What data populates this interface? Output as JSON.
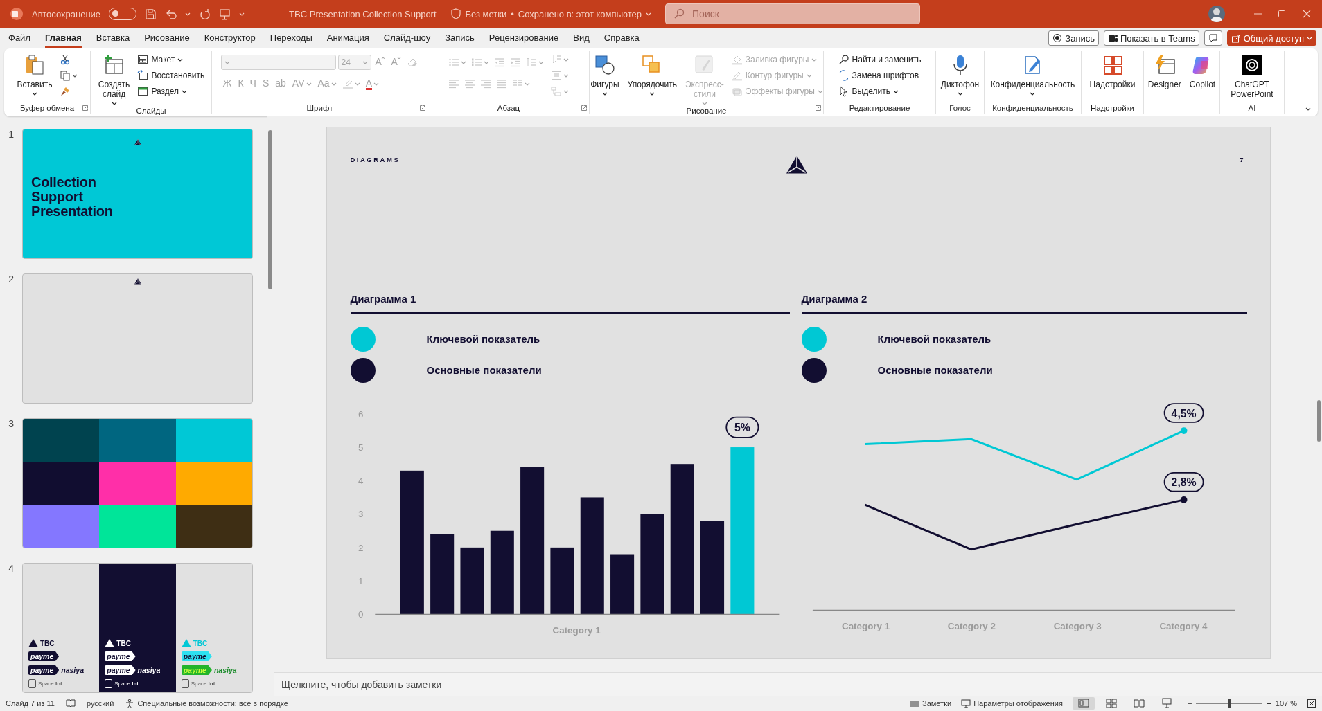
{
  "title_bar": {
    "autosave": {
      "label": "Автосохранение",
      "on": false
    },
    "document_title": "TBC Presentation Collection Support",
    "sensitivity": "Без метки",
    "separator": "•",
    "save_status": "Сохранено в: этот компьютер",
    "search": {
      "placeholder": "Поиск"
    }
  },
  "menu": {
    "tabs": [
      {
        "label": "Файл",
        "selected": false
      },
      {
        "label": "Главная",
        "selected": true
      },
      {
        "label": "Вставка",
        "selected": false
      },
      {
        "label": "Рисование",
        "selected": false
      },
      {
        "label": "Конструктор",
        "selected": false
      },
      {
        "label": "Переходы",
        "selected": false
      },
      {
        "label": "Анимация",
        "selected": false
      },
      {
        "label": "Слайд-шоу",
        "selected": false
      },
      {
        "label": "Запись",
        "selected": false
      },
      {
        "label": "Рецензирование",
        "selected": false
      },
      {
        "label": "Вид",
        "selected": false
      },
      {
        "label": "Справка",
        "selected": false
      }
    ],
    "actions": [
      {
        "kind": "record",
        "label": "Запись"
      },
      {
        "kind": "teams",
        "label": "Показать в Teams"
      },
      {
        "kind": "comment"
      },
      {
        "kind": "share",
        "label": "Общий доступ"
      }
    ]
  },
  "ribbon": {
    "groups": [
      {
        "label": "Буфер обмена",
        "launcher": true,
        "items": [
          {
            "kind": "large",
            "label": "Вставить",
            "caret": true,
            "disabled": false
          },
          {
            "kind": "column",
            "items": [
              {
                "kind": "icon",
                "caret": false,
                "disabled": false
              },
              {
                "kind": "icon",
                "caret": true,
                "disabled": false
              },
              {
                "kind": "icon",
                "caret": false,
                "disabled": false
              }
            ]
          }
        ]
      },
      {
        "label": "Слайды",
        "launcher": false,
        "items": [
          {
            "kind": "large",
            "label": "Создать слайд",
            "caret": true,
            "disabled": false
          },
          {
            "kind": "column",
            "items": [
              {
                "kind": "small",
                "label": "Макет",
                "caret": true,
                "disabled": false
              },
              {
                "kind": "small",
                "label": "Восстановить",
                "caret": false,
                "disabled": false
              },
              {
                "kind": "small",
                "label": "Раздел",
                "caret": true,
                "disabled": false
              }
            ]
          }
        ]
      },
      {
        "label": "Шрифт",
        "launcher": true,
        "items": [
          {
            "kind": "column",
            "items": [
              {
                "kind": "row",
                "items": [
                  {
                    "kind": "combo",
                    "caret": true,
                    "disabled": true
                  },
                  {
                    "kind": "field",
                    "value": "24",
                    "caret": true,
                    "disabled": true
                  },
                  {
                    "kind": "glyph",
                    "label": "Aˆ",
                    "underline": false,
                    "caret": false,
                    "disabled": true
                  },
                  {
                    "kind": "glyph",
                    "label": "Aˇ",
                    "underline": false,
                    "caret": false,
                    "disabled": true
                  },
                  {
                    "kind": "icon",
                    "caret": false,
                    "disabled": true
                  }
                ]
              },
              {
                "kind": "row",
                "items": [
                  {
                    "kind": "glyph",
                    "label": "Ж",
                    "underline": false,
                    "caret": false,
                    "disabled": true
                  },
                  {
                    "kind": "glyph",
                    "label": "К",
                    "underline": false,
                    "caret": false,
                    "disabled": true
                  },
                  {
                    "kind": "glyph",
                    "label": "Ч",
                    "underline": false,
                    "caret": false,
                    "disabled": true
                  },
                  {
                    "kind": "glyph",
                    "label": "S",
                    "underline": false,
                    "caret": false,
                    "disabled": true
                  },
                  {
                    "kind": "glyph",
                    "label": "ab",
                    "underline": false,
                    "caret": false,
                    "disabled": true
                  },
                  {
                    "kind": "glyph",
                    "label": "AV",
                    "underline": false,
                    "caret": true,
                    "disabled": true
                  },
                  {
                    "kind": "glyph",
                    "label": "Aa",
                    "underline": false,
                    "caret": true,
                    "disabled": true
                  },
                  {
                    "kind": "icon",
                    "caret": true,
                    "disabled": true
                  },
                  {
                    "kind": "glyph",
                    "label": "A",
                    "underline": true,
                    "caret": true,
                    "disabled": true
                  }
                ]
              }
            ]
          }
        ]
      },
      {
        "label": "Абзац",
        "launcher": true,
        "items": [
          {
            "kind": "column",
            "items": [
              {
                "kind": "row",
                "items": [
                  {
                    "kind": "icon",
                    "caret": true,
                    "disabled": true
                  },
                  {
                    "kind": "icon",
                    "caret": true,
                    "disabled": true
                  },
                  {
                    "kind": "icon",
                    "caret": false,
                    "disabled": true
                  },
                  {
                    "kind": "icon",
                    "caret": false,
                    "disabled": true
                  },
                  {
                    "kind": "icon",
                    "caret": true,
                    "disabled": true
                  }
                ]
              },
              {
                "kind": "row",
                "items": [
                  {
                    "kind": "icon",
                    "caret": false,
                    "disabled": true
                  },
                  {
                    "kind": "icon",
                    "caret": false,
                    "disabled": true
                  },
                  {
                    "kind": "icon",
                    "caret": false,
                    "disabled": true
                  },
                  {
                    "kind": "icon",
                    "caret": false,
                    "disabled": true
                  },
                  {
                    "kind": "icon",
                    "caret": true,
                    "disabled": true
                  }
                ]
              }
            ]
          },
          {
            "kind": "column",
            "items": [
              {
                "kind": "icon",
                "caret": true,
                "disabled": true
              },
              {
                "kind": "icon",
                "caret": true,
                "disabled": true
              },
              {
                "kind": "icon",
                "caret": true,
                "disabled": true
              }
            ]
          }
        ]
      },
      {
        "label": "Рисование",
        "launcher": true,
        "items": [
          {
            "kind": "large",
            "label": "Фигуры",
            "caret": true,
            "disabled": false
          },
          {
            "kind": "large",
            "label": "Упорядочить",
            "caret": true,
            "disabled": false
          },
          {
            "kind": "large",
            "label": "Экспресс-стили",
            "caret": true,
            "disabled": true
          },
          {
            "kind": "column",
            "items": [
              {
                "kind": "small",
                "label": "Заливка фигуры",
                "caret": true,
                "disabled": true
              },
              {
                "kind": "small",
                "label": "Контур фигуры",
                "caret": true,
                "disabled": true
              },
              {
                "kind": "small",
                "label": "Эффекты фигуры",
                "caret": true,
                "disabled": true
              }
            ]
          }
        ]
      },
      {
        "label": "Редактирование",
        "launcher": false,
        "items": [
          {
            "kind": "column",
            "items": [
              {
                "kind": "small",
                "label": "Найти и заменить",
                "caret": false,
                "disabled": false
              },
              {
                "kind": "small",
                "label": "Замена шрифтов",
                "caret": false,
                "disabled": false
              },
              {
                "kind": "small",
                "label": "Выделить",
                "caret": true,
                "disabled": false
              }
            ]
          }
        ]
      },
      {
        "label": "Голос",
        "launcher": false,
        "items": [
          {
            "kind": "large",
            "label": "Диктофон",
            "caret": true,
            "disabled": false
          }
        ]
      },
      {
        "label": "Конфиденциальность",
        "launcher": false,
        "items": [
          {
            "kind": "large",
            "label": "Конфиденциальность",
            "caret": true,
            "disabled": false
          }
        ]
      },
      {
        "label": "Надстройки",
        "launcher": false,
        "items": [
          {
            "kind": "large",
            "label": "Надстройки",
            "caret": false,
            "disabled": false
          }
        ]
      },
      {
        "items": [
          {
            "kind": "large",
            "label": "Designer",
            "caret": false,
            "disabled": false
          },
          {
            "kind": "large",
            "label": "Copilot",
            "caret": false,
            "disabled": false
          }
        ]
      },
      {
        "label": "AI",
        "launcher": false,
        "items": [
          {
            "kind": "large",
            "label": "ChatGPT PowerPoint",
            "caret": false,
            "disabled": false
          }
        ]
      }
    ]
  },
  "slides_panel": {
    "slides": [
      {
        "number": "1",
        "kind": "title",
        "title": "Collection Support Presentation",
        "selected": false
      },
      {
        "number": "2",
        "kind": "blank",
        "selected": false
      },
      {
        "number": "3",
        "kind": "palette",
        "selected": false,
        "swatches": [
          {
            "color": "#00434f"
          },
          {
            "color": "#006680"
          },
          {
            "color": "#00c8d6"
          },
          {
            "color": "#110d30"
          },
          {
            "color": "#ff2fa8"
          },
          {
            "color": "#ffaa00"
          },
          {
            "color": "#8477ff"
          },
          {
            "color": "#00e599"
          },
          {
            "color": "#3e2e14"
          }
        ]
      },
      {
        "number": "4",
        "kind": "logos",
        "selected": false,
        "columns": [
          {
            "kind": "light",
            "brand": "TBC",
            "badge": "payme",
            "badge2": "payme",
            "suffix": "nasiya",
            "footer": "Space **Int.**"
          },
          {
            "kind": "dark",
            "brand": "TBC",
            "badge": "payme",
            "badge2": "payme",
            "suffix": "nasiya",
            "footer": "Space **Int.**"
          },
          {
            "kind": "color",
            "brand": "TBC",
            "badge": "payme",
            "badge2": "payme",
            "suffix": "nasiya",
            "footer": "Space **Int.**"
          }
        ]
      }
    ]
  },
  "slide": {
    "header": "DIAGRAMS",
    "page_number": "7",
    "charts": [
      {
        "kind": "bar",
        "title": "Диаграмма 1",
        "chart_data": {
          "type": "bar",
          "xlabel": "Category 1",
          "ylim": [
            0,
            6
          ],
          "yticks": [
            0,
            1,
            2,
            3,
            4,
            5,
            6
          ],
          "stacked": true,
          "series": [
            {
              "name": "Ключевой показатель",
              "color": "#00c8d4",
              "values": [
                null,
                null,
                null,
                null,
                null,
                null,
                null,
                null,
                null,
                null,
                null,
                5.0
              ]
            },
            {
              "name": "Основные показатели",
              "color": "#120e31",
              "values": [
                4.3,
                2.4,
                2.0,
                2.5,
                4.4,
                2.0,
                3.5,
                1.8,
                3.0,
                4.5,
                2.8,
                null
              ]
            }
          ],
          "value_labels": [
            null,
            null,
            null,
            null,
            null,
            null,
            null,
            null,
            null,
            null,
            null,
            "5%"
          ]
        }
      },
      {
        "kind": "line",
        "title": "Диаграмма 2",
        "legend": [
          {
            "label": "Ключевой показатель",
            "color": "#00c8d4"
          },
          {
            "label": "Основные показатели",
            "color": "#120e31"
          }
        ],
        "categories": [
          "Category 1",
          "Category 2",
          "Category 3",
          "Category 4"
        ],
        "end_labels": [
          "4,5%",
          "2,8%"
        ]
      }
    ]
  },
  "notes": {
    "placeholder": "Щелкните, чтобы добавить заметки"
  },
  "status_bar": {
    "slide_info": "Слайд 7 из 11",
    "language": "русский",
    "accessibility": "Специальные возможности: все в порядке",
    "notes": "Заметки",
    "display_settings": "Параметры отображения",
    "views": [
      {
        "selected": true
      },
      {
        "selected": false
      },
      {
        "selected": false
      },
      {
        "selected": false
      }
    ],
    "zoom": {
      "minus": "−",
      "plus": "+",
      "level": 0.5,
      "reading": "107 %"
    }
  }
}
